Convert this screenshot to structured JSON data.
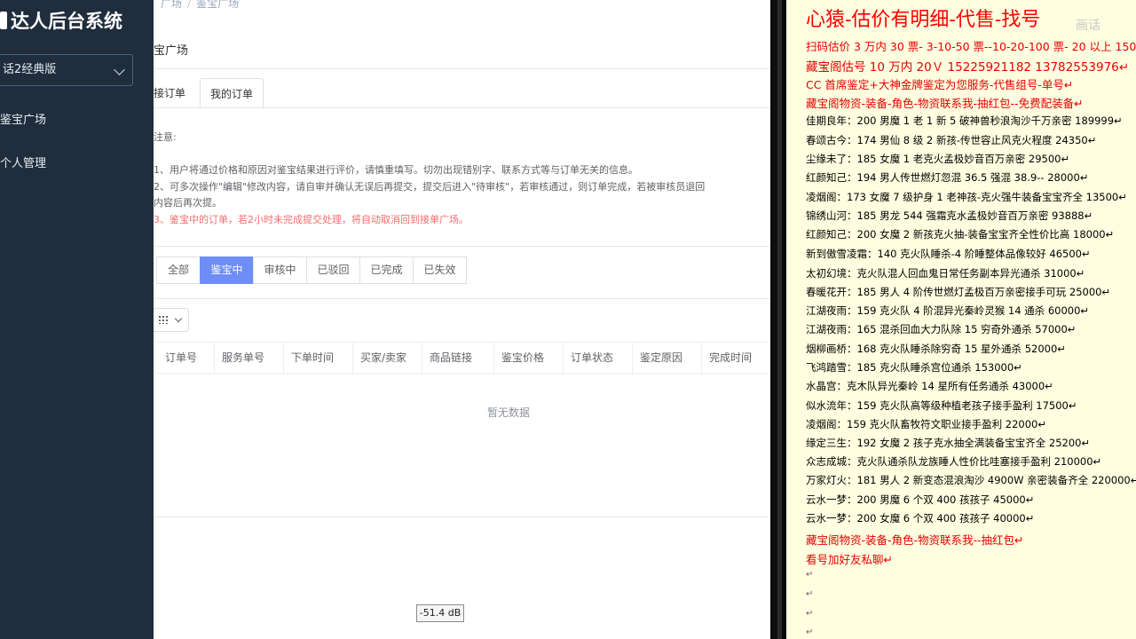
{
  "sidebar": {
    "title": "达人后台系统",
    "version_select": "话2经典版",
    "items": [
      {
        "label": "鉴宝广场"
      },
      {
        "label": "个人管理"
      }
    ]
  },
  "main": {
    "breadcrumb": [
      "广场",
      "鉴宝广场"
    ],
    "page_title": "宝广场",
    "tabs": [
      {
        "label": "接订单"
      },
      {
        "label": "我的订单"
      }
    ],
    "notice_title": "注意:",
    "notices": [
      "1、用户将通过价格和原因对鉴宝结果进行评价，请慎重填写。切勿出现错别字、联系方式等与订单无关的信息。",
      "2、可多次操作\"编辑\"修改内容，请自审并确认无误后再提交，提交后进入\"待审核\"，若审核通过，则订单完成，若被审核员退回",
      "内容后再次提。",
      "3、鉴宝中的订单，若2小时未完成提交处理，将自动取消回到接单广场。"
    ],
    "filters": [
      "全部",
      "鉴宝中",
      "审核中",
      "已驳回",
      "已完成",
      "已失效"
    ],
    "active_filter": "鉴宝中",
    "columns": [
      "订单号",
      "服务单号",
      "下单时间",
      "买家/卖家",
      "商品链接",
      "鉴宝价格",
      "订单状态",
      "鉴定原因",
      "完成时间"
    ],
    "empty_text": "暂无数据",
    "db_level": "-51.4 dB"
  },
  "notes": {
    "header": "心猿-估价有明细-代售-找号",
    "watermark": "画话",
    "lines": [
      {
        "text": "扫码估价 3 万内 30 票- 3-10-50 票--10-20-100 票- 20 以上 150↵",
        "style": "red"
      },
      {
        "text": "藏宝阁估号 10 万内 20Ｖ 15225921182   13782553976↵",
        "style": "red big"
      },
      {
        "text": "CC 首席鉴定+大神金牌鉴定为您服务-代售组号-单号↵",
        "style": "red"
      },
      {
        "text": "藏宝阁物资-装备-角色-物资联系我-抽红包--免费配装备↵",
        "style": "red"
      },
      {
        "text": "佳期良年：200 男魔 1 老 1 新 5 破神兽秒浪淘沙千万亲密 189999↵",
        "style": ""
      },
      {
        "text": "春颂古今：174 男仙 8 级 2 新孩-传世容止风克火程度 24350↵",
        "style": ""
      },
      {
        "text": "尘缘未了：185 女魔 1 老克火孟极妙音百万亲密 29500↵",
        "style": ""
      },
      {
        "text": "红颜知己：194 男人传世燃灯忽混 36.5 强混 38.9-- 28000↵",
        "style": ""
      },
      {
        "text": "凌烟阁：173 女魔 7 级护身 1 老神孩-克火强牛装备宝宝齐全 13500↵",
        "style": ""
      },
      {
        "text": "锦绣山河：185 男龙 544 强霜克水孟极妙音百万亲密 93888↵",
        "style": ""
      },
      {
        "text": "红颜知己：200 女魔 2 新孩克火抽-装备宝宝齐全性价比高 18000↵",
        "style": ""
      },
      {
        "text": "新到傲雪凌霜：140 克火队睡杀-4 阶睡整体品像较好 46500↵",
        "style": ""
      },
      {
        "text": "太初幻境：克火队混人回血鬼日常任务副本异光通杀 31000↵",
        "style": ""
      },
      {
        "text": "春暖花开：185 男人 4 阶传世燃灯孟极百万亲密接手可玩 25000↵",
        "style": ""
      },
      {
        "text": "江湖夜雨：159 克火队 4 阶混异光秦岭灵猴 14 通杀 60000↵",
        "style": ""
      },
      {
        "text": "江湖夜雨：165 混杀回血大力队除 15 穷奇外通杀 57000↵",
        "style": ""
      },
      {
        "text": "烟柳画桥：168 克火队睡杀除穷奇 15 星外通杀 52000↵",
        "style": ""
      },
      {
        "text": "飞鸿踏雪：185 克火队睡杀宫位通杀 153000↵",
        "style": ""
      },
      {
        "text": "水晶宫：克木队异光秦岭 14 星所有任务通杀 43000↵",
        "style": ""
      },
      {
        "text": "似水流年：159 克火队高等级种植老孩子接手盈利 17500↵",
        "style": ""
      },
      {
        "text": "凌烟阁：159 克火队畜牧符文职业接手盈利 22000↵",
        "style": ""
      },
      {
        "text": "缘定三生：192 女魔 2 孩子克水抽全满装备宝宝齐全 25200↵",
        "style": ""
      },
      {
        "text": "众志成城：克火队通杀队龙族睡人性价比哇塞接手盈利 210000↵",
        "style": ""
      },
      {
        "text": "万家灯火：181 男人 2 新变态混浪淘沙 4900W 亲密装备齐全 220000↵",
        "style": ""
      },
      {
        "text": "云水一梦：200 男魔 6 个双 400 孩孩子 45000↵",
        "style": ""
      },
      {
        "text": "云水一梦：200 女魔 6 个双 400 孩孩子 40000↵",
        "style": ""
      },
      {
        "text": "藏宝阁物资-装备-角色-物资联系我--抽红包↵",
        "style": "red"
      },
      {
        "text": "看号加好友私聊↵",
        "style": "red"
      }
    ],
    "empty_marks": [
      "↵",
      "↵",
      "↵",
      "↵"
    ]
  },
  "colors": {
    "sidebar_bg": "#1f2d3d",
    "accent": "#6f8ef5",
    "notice_red": "#f56c6c",
    "note_red": "#e60000",
    "note_bg": "#fffee0"
  }
}
